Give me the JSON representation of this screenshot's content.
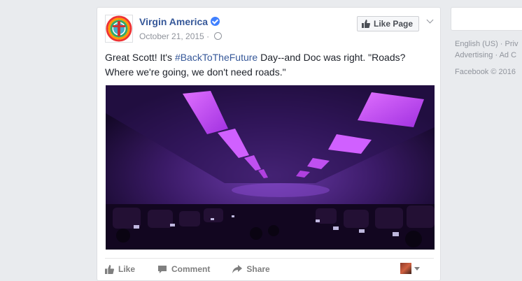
{
  "post": {
    "page_name": "Virgin America",
    "date": "October 21, 2015",
    "meta_separator": "·",
    "like_page_label": "Like Page",
    "text_before": "Great Scott! It's ",
    "hashtag": "#BackToTheFuture",
    "text_after": " Day--and Doc was right. \"Roads? Where we're going, we don't need roads.\"",
    "image_description_icon": "airplane-cabin-photo"
  },
  "actions": {
    "like": "Like",
    "comment": "Comment",
    "share": "Share"
  },
  "sidebar": {
    "footer_lang": "English (US)",
    "footer_priv": "Priv",
    "footer_adv": "Advertising",
    "footer_ad": "Ad C",
    "footer_copy": "Facebook © 2016"
  },
  "colors": {
    "link": "#365899",
    "background": "#e9ebee",
    "cabin_glow": "#c040ff"
  }
}
